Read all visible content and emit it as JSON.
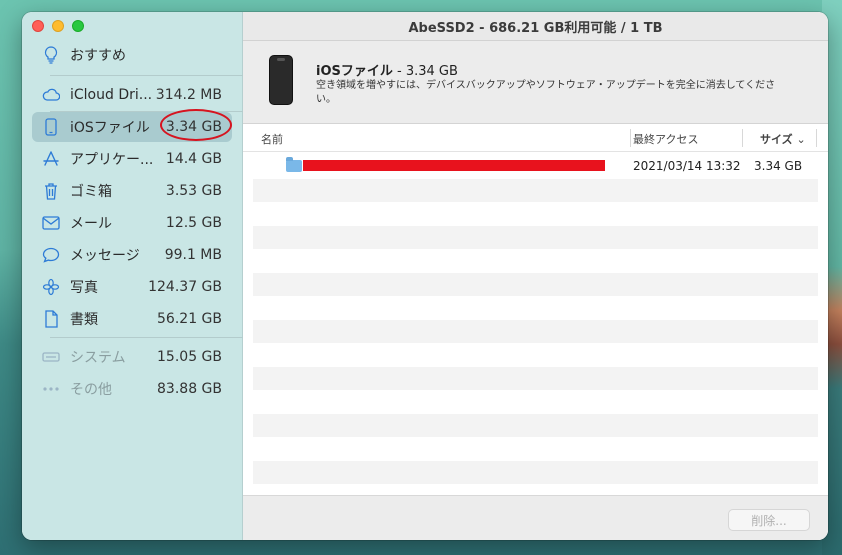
{
  "window": {
    "title": "AbeSSD2 - 686.21 GB利用可能 / 1 TB"
  },
  "sidebar": {
    "items": [
      {
        "label": "おすすめ",
        "size": "",
        "icon": "lightbulb-icon"
      },
      {
        "label": "iCloud Dri...",
        "size": "314.2 MB",
        "icon": "cloud-icon"
      },
      {
        "label": "iOSファイル",
        "size": "3.34 GB",
        "icon": "phone-icon"
      },
      {
        "label": "アプリケー...",
        "size": "14.4 GB",
        "icon": "app-store-icon"
      },
      {
        "label": "ゴミ箱",
        "size": "3.53 GB",
        "icon": "trash-icon"
      },
      {
        "label": "メール",
        "size": "12.5 GB",
        "icon": "mail-icon"
      },
      {
        "label": "メッセージ",
        "size": "99.1 MB",
        "icon": "message-icon"
      },
      {
        "label": "写真",
        "size": "124.37 GB",
        "icon": "photos-icon"
      },
      {
        "label": "書類",
        "size": "56.21 GB",
        "icon": "document-icon"
      },
      {
        "label": "システム",
        "size": "15.05 GB",
        "icon": "system-icon"
      },
      {
        "label": "その他",
        "size": "83.88 GB",
        "icon": "more-icon"
      }
    ]
  },
  "header": {
    "title_bold": "iOSファイル",
    "title_rest": " - 3.34 GB",
    "description": "空き領域を増やすには、デバイスバックアップやソフトウェア・アップデートを完全に消去してください。"
  },
  "table": {
    "col_name": "名前",
    "col_access": "最終アクセス",
    "col_size": "サイズ",
    "rows": [
      {
        "name": "",
        "date": "2021/03/14 13:32",
        "size": "3.34 GB"
      }
    ]
  },
  "footer": {
    "delete_label": "削除..."
  },
  "colors": {
    "accent": "#2d7bd6",
    "selection": "#a9cbcf",
    "annotation": "#d6141f",
    "redaction": "#e8121d"
  }
}
